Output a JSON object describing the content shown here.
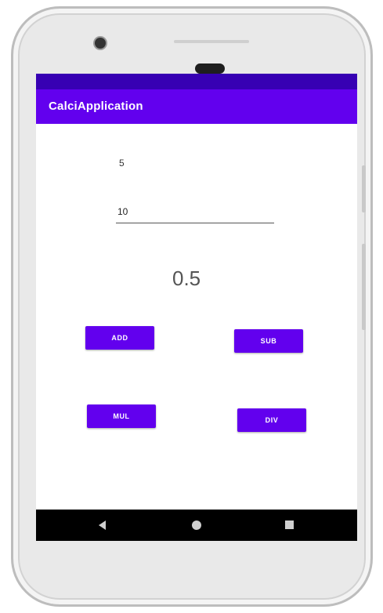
{
  "app": {
    "title": "CalciApplication"
  },
  "inputs": {
    "first_number": "5",
    "second_number": "10"
  },
  "result": {
    "value": "0.5"
  },
  "buttons": {
    "add": "ADD",
    "sub": "SUB",
    "mul": "MUL",
    "div": "DIV"
  },
  "colors": {
    "primary": "#6200ee",
    "primary_dark": "#3700b3"
  },
  "nav_icons": [
    "back-icon",
    "home-icon",
    "recents-icon"
  ]
}
